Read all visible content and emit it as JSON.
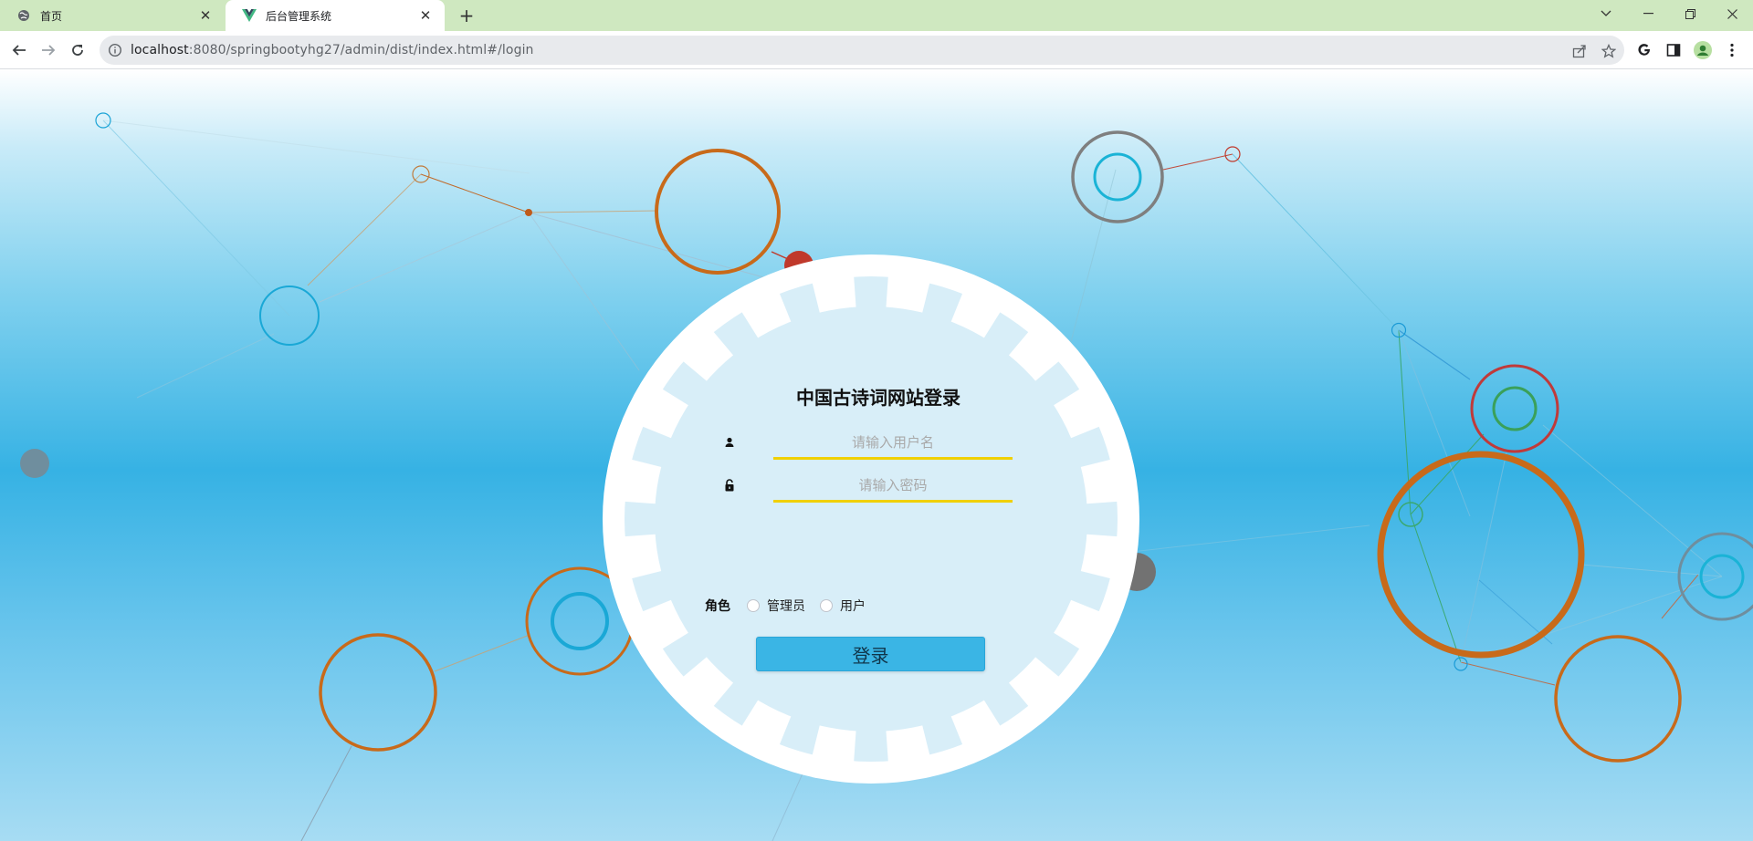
{
  "browser": {
    "tabs": [
      {
        "title": "首页",
        "icon": "globe-icon",
        "active": false
      },
      {
        "title": "后台管理系统",
        "icon": "vue-logo-icon",
        "active": true
      }
    ],
    "address": {
      "host": "localhost",
      "path": ":8080/springbootyhg27/admin/dist/index.html#/login"
    }
  },
  "login": {
    "title": "中国古诗词网站登录",
    "username_placeholder": "请输入用户名",
    "password_placeholder": "请输入密码",
    "role_label": "角色",
    "roles": [
      "管理员",
      "用户"
    ],
    "submit_label": "登录"
  },
  "colors": {
    "accent": "#3ab5e5",
    "input_underline": "#f0d000",
    "tabstrip": "#cfe8c0"
  }
}
